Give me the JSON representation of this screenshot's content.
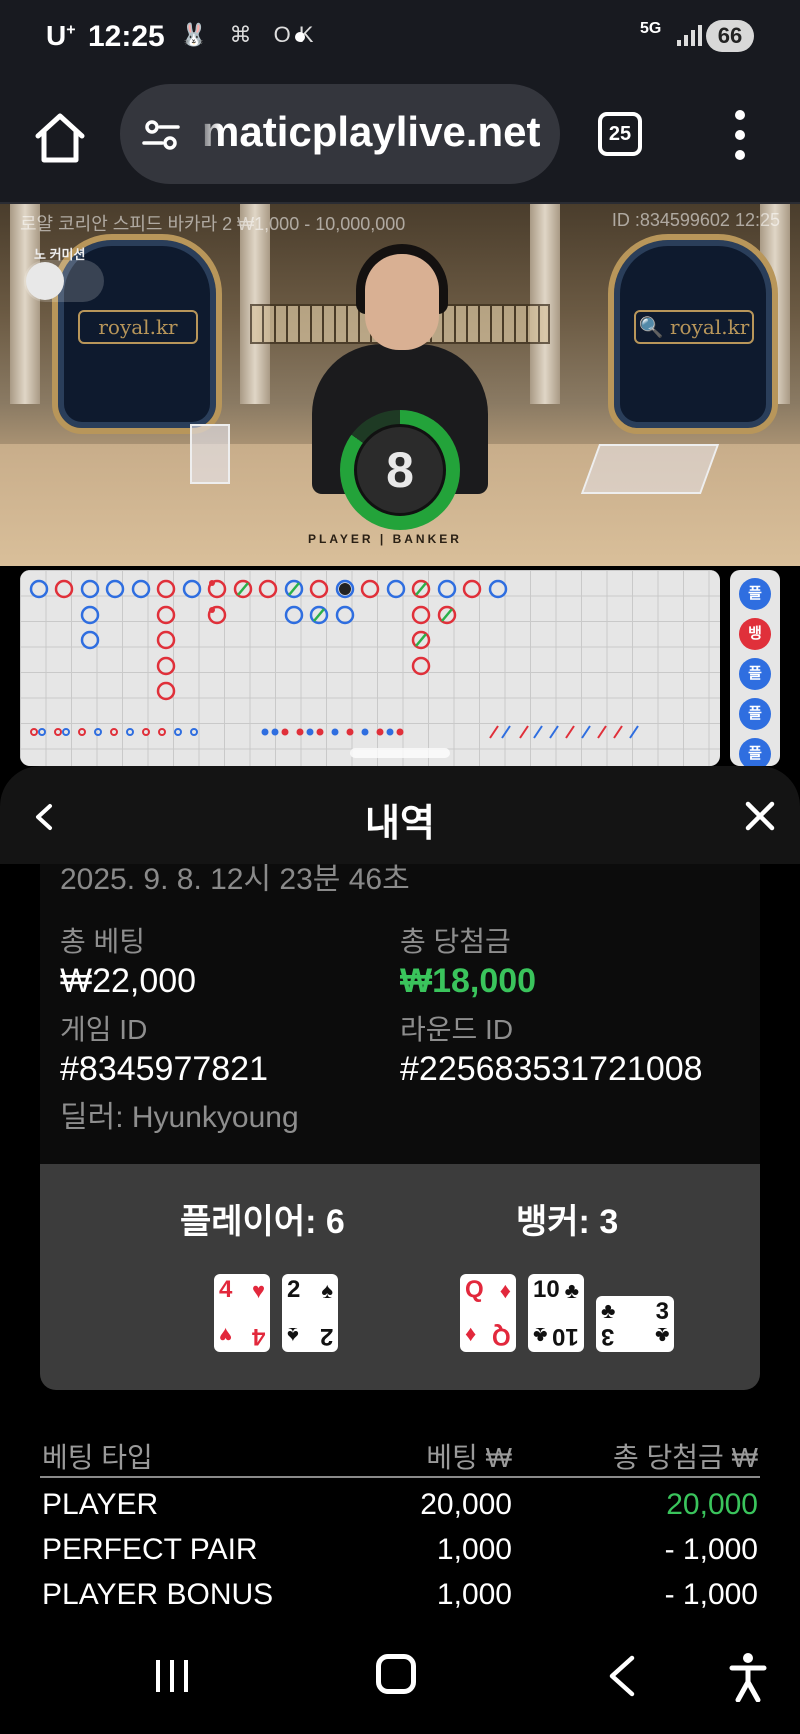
{
  "status_bar": {
    "carrier": "U",
    "carrier_sup": "+",
    "time": "12:25",
    "notif_icons": "🐰 ⌘ OK",
    "network": "5G",
    "battery": "66"
  },
  "browser": {
    "url": "maticplaylive.net",
    "tab_count": "25"
  },
  "video": {
    "table_info": "로얄 코리안 스피드 바카라 2 ₩1,000 - 10,000,000",
    "round_info": "ID :834599602 12:25",
    "no_commission_label": "노 커미션",
    "arch_left_label": "royal.kr",
    "arch_right_label": "🔍 royal.kr",
    "timer_value": "8",
    "player_banker_text": "PLAYER | BANKER"
  },
  "prediction": {
    "items": [
      {
        "label": "플",
        "color": "#2f6ee0"
      },
      {
        "label": "뱅",
        "color": "#e0303a"
      },
      {
        "label": "플",
        "color": "#2f6ee0"
      },
      {
        "label": "플",
        "color": "#2f6ee0"
      },
      {
        "label": "플",
        "color": "#2f6ee0"
      }
    ]
  },
  "sheet": {
    "title": "내역",
    "date": "2025. 9. 8. 12시 23분 46초",
    "total_bet_label": "총 베팅",
    "total_bet_value": "₩22,000",
    "total_win_label": "총 당첨금",
    "total_win_value": "₩18,000",
    "game_id_label": "게임 ID",
    "game_id_value": "#8345977821",
    "round_id_label": "라운드 ID",
    "round_id_value": "#225683531721008",
    "dealer": "딜러: Hyunkyoung",
    "player_hand": "플레이어: 6",
    "banker_hand": "뱅커: 3",
    "player_cards": [
      {
        "rank": "4",
        "suit": "♥"
      },
      {
        "rank": "2",
        "suit": "♠"
      }
    ],
    "banker_cards": [
      {
        "rank": "Q",
        "suit": "♦"
      },
      {
        "rank": "10",
        "suit": "♣"
      },
      {
        "rank": "3",
        "suit": "♣"
      }
    ],
    "bets_header": {
      "type": "베팅 타입",
      "bet": "베팅 ₩",
      "win": "총 당첨금 ₩"
    },
    "bets": [
      {
        "type": "PLAYER",
        "bet": "20,000",
        "win": "20,000",
        "positive": true
      },
      {
        "type": "PERFECT PAIR",
        "bet": "1,000",
        "win": "- 1,000",
        "positive": false
      },
      {
        "type": "PLAYER BONUS",
        "bet": "1,000",
        "win": "- 1,000",
        "positive": false
      }
    ]
  }
}
